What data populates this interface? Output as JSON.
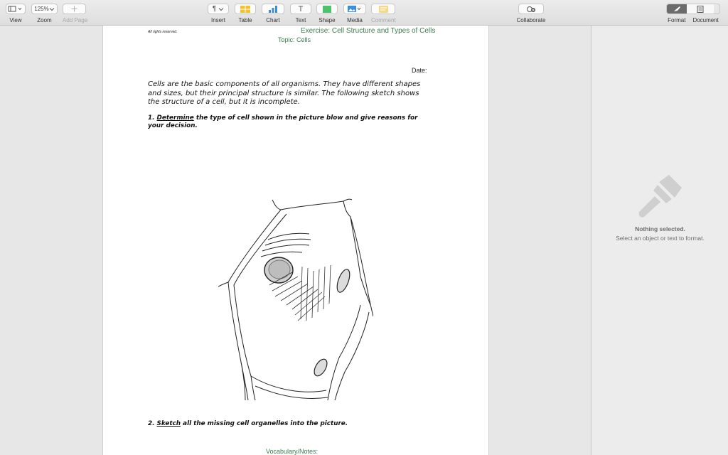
{
  "toolbar": {
    "view_label": "View",
    "zoom_value": "125%",
    "zoom_label": "Zoom",
    "add_page_label": "Add Page",
    "insert_label": "Insert",
    "table_label": "Table",
    "chart_label": "Chart",
    "text_label": "Text",
    "shape_label": "Shape",
    "media_label": "Media",
    "comment_label": "Comment",
    "collaborate_label": "Collaborate",
    "format_label": "Format",
    "document_label": "Document"
  },
  "document": {
    "rights": "All rights reserved.",
    "exercise_title": "Exercise: Cell Structure and Types of Cells",
    "topic": "Topic: Cells",
    "date_label": "Date:",
    "intro": "Cells are the basic components of all organisms. They have different shapes and sizes, but their principal structure is similar. The following sketch shows the structure of a cell, but it is incomplete.",
    "q1_number": "1.",
    "q1_verb": "Determine",
    "q1_rest": " the type of cell shown in the picture blow and give reasons for your decision.",
    "q2_number": "2.",
    "q2_verb": "Sketch",
    "q2_rest": " all the missing cell organelles into the picture.",
    "vocab": "Vocabulary/Notes:"
  },
  "inspector": {
    "title": "Nothing selected.",
    "subtitle": "Select an object or text to format."
  },
  "colors": {
    "accent_green": "#3d7c50",
    "shape_green": "#4cc36a",
    "table_yellow": "#f2c230",
    "chart_blue": "#3a8ee0",
    "segment_active": "#6b6b6b"
  },
  "icons": [
    "view-icon",
    "add-icon",
    "paragraph-icon",
    "table-icon",
    "chart-icon",
    "text-icon",
    "shape-icon",
    "media-icon",
    "comment-icon",
    "collaborate-icon",
    "paintbrush-icon",
    "document-icon",
    "shift-key-icon",
    "command-key-icon"
  ]
}
